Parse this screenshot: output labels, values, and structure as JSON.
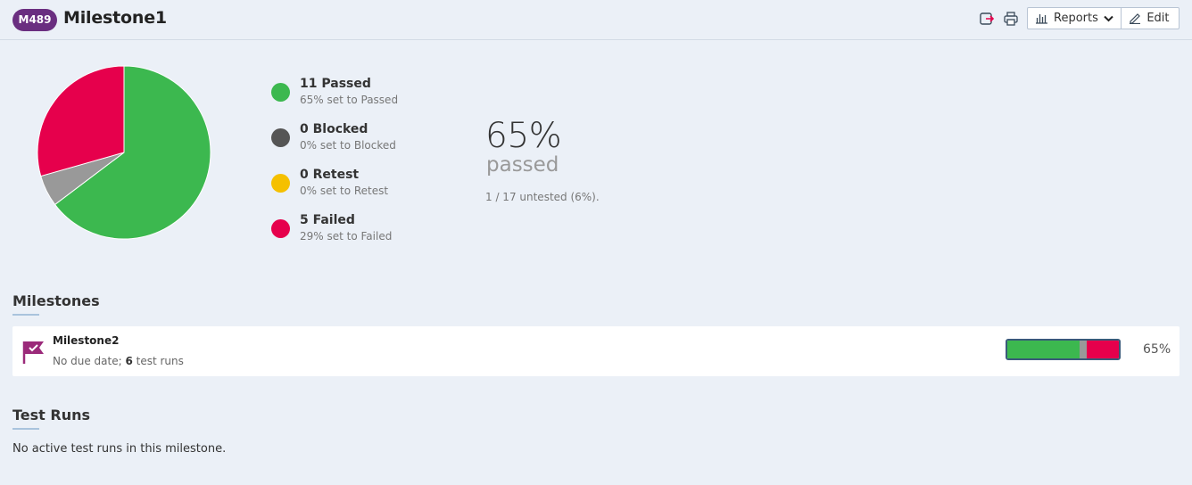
{
  "header": {
    "badge": "M489",
    "title": "Milestone1",
    "reports_label": "Reports",
    "edit_label": "Edit"
  },
  "colors": {
    "passed": "#3cb84f",
    "blocked": "#555555",
    "retest": "#f5c000",
    "failed": "#e6004c",
    "untested": "#999999",
    "badge": "#6a2e80"
  },
  "legend": [
    {
      "status": "passed",
      "title": "11 Passed",
      "sub": "65% set to Passed"
    },
    {
      "status": "blocked",
      "title": "0 Blocked",
      "sub": "0% set to Blocked"
    },
    {
      "status": "retest",
      "title": "0 Retest",
      "sub": "0% set to Retest"
    },
    {
      "status": "failed",
      "title": "5 Failed",
      "sub": "29% set to Failed"
    }
  ],
  "summary": {
    "percent": "65%",
    "label": "passed",
    "untested": "1 / 17 untested (6%)."
  },
  "pie": {
    "slices": [
      {
        "status": "passed",
        "value": 11
      },
      {
        "status": "untested",
        "value": 1
      },
      {
        "status": "failed",
        "value": 5
      }
    ]
  },
  "milestones_section": {
    "title": "Milestones",
    "items": [
      {
        "name": "Milestone2",
        "due_prefix": "No due date; ",
        "runs_count": "6",
        "runs_suffix": " test runs",
        "percent": "65%",
        "progress": {
          "passed": 0.65,
          "untested": 0.06,
          "failed": 0.29
        }
      }
    ]
  },
  "test_runs_section": {
    "title": "Test Runs",
    "empty_text": "No active test runs in this milestone."
  }
}
